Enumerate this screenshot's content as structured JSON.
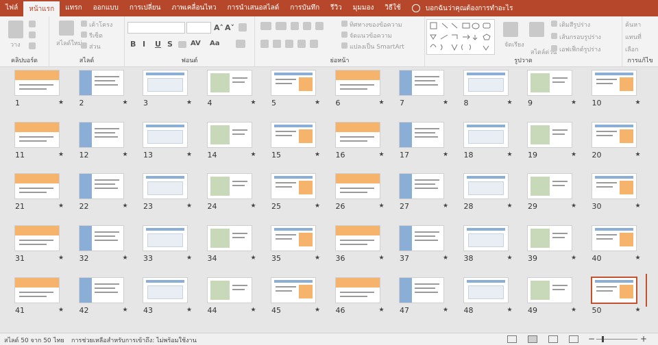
{
  "tabs": [
    "ไฟล์",
    "หน้าแรก",
    "แทรก",
    "ออกแบบ",
    "การเปลี่ยน",
    "ภาพเคลื่อนไหว",
    "การนำเสนอสไลด์",
    "การบันทึก",
    "รีวิว",
    "มุมมอง",
    "วิธีใช้"
  ],
  "active_tab": "หน้าแรก",
  "tell_me": "บอกฉันว่าคุณต้องการทำอะไร",
  "ribbon": {
    "clipboard": {
      "label": "คลิปบอร์ด",
      "paste": "วาง"
    },
    "slides": {
      "label": "สไลด์",
      "new_slide": "สไลด์ใหม่",
      "layout": "เค้าโครง",
      "reset": "รีเซ็ต",
      "section": "ส่วน"
    },
    "font": {
      "label": "ฟอนต์",
      "bold": "B",
      "italic": "I",
      "underline": "U",
      "strike": "S",
      "size_up": "A˄",
      "size_down": "A˅",
      "spacing": "AV",
      "case": "Aa"
    },
    "paragraph": {
      "label": "ย่อหน้า",
      "text_direction": "ทิศทางของข้อความ",
      "align_text": "จัดแนวข้อความ",
      "smartart": "แปลงเป็น SmartArt"
    },
    "drawing": {
      "label": "รูปวาด",
      "arrange": "จัดเรียง",
      "quick_styles": "สไตล์ด่วน",
      "fill": "เติมสีรูปร่าง",
      "outline": "เส้นกรอบรูปร่าง",
      "effects": "เอฟเฟ็กต์รูปร่าง"
    },
    "editing": {
      "label": "การแก้ไข",
      "find": "ค้นหา",
      "replace": "แทนที่",
      "select": "เลือก"
    }
  },
  "slide_count": 50,
  "selected_slide": 50,
  "status": {
    "slide_info": "สไลด์ 50 จาก 50",
    "language": "ไทย",
    "accessibility": "การช่วยเหลือสำหรับการเข้าถึง: ไม่พร้อมใช้งาน"
  },
  "colors": {
    "accent": "#b7472a",
    "selection": "#c24f2e",
    "thumb_blue": "#8aaed6",
    "thumb_orange": "#f5b36b"
  }
}
